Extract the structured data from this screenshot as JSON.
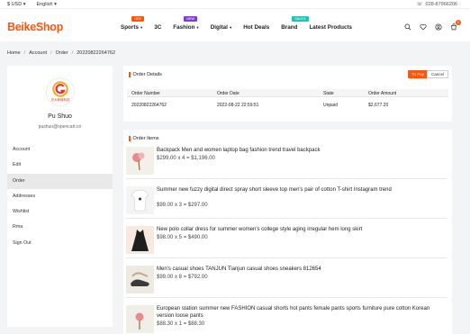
{
  "topbar": {
    "currency": "$ USD",
    "language": "English",
    "phone": "028-87966206"
  },
  "header": {
    "logo": "BeikeShop",
    "nav": [
      {
        "label": "Sports",
        "badge": "HOT",
        "badge_color": "#fd560f",
        "dropdown": true
      },
      {
        "label": "3C",
        "badge": "",
        "badge_color": "",
        "dropdown": false
      },
      {
        "label": "Fashion",
        "badge": "NEW",
        "badge_color": "#7e3fd0",
        "dropdown": true
      },
      {
        "label": "Digital",
        "badge": "",
        "badge_color": "",
        "dropdown": true
      },
      {
        "label": "Hot Deals",
        "badge": "",
        "badge_color": "",
        "dropdown": false
      },
      {
        "label": "Brand",
        "badge": "SALES",
        "badge_color": "#21c1b3",
        "dropdown": false
      },
      {
        "label": "Latest Products",
        "badge": "",
        "badge_color": "",
        "dropdown": false
      }
    ],
    "icons": [
      "search-icon",
      "heart-icon",
      "user-icon",
      "cart-icon"
    ],
    "cart_count": "0"
  },
  "breadcrumb": [
    "Home",
    "Account",
    "Order",
    "20220822264762"
  ],
  "sidebar": {
    "avatar_brand": "光大商城科技",
    "user_name": "Pu Shuo",
    "user_email": "pushuo@opencart.cn",
    "menu": [
      "Account",
      "Edit",
      "Order",
      "Addresses",
      "Wishlist",
      "Rma",
      "Sign Out"
    ],
    "active_index": 2
  },
  "order_details": {
    "title": "Order Details",
    "pay_label": "To Pay",
    "cancel_label": "Cancel",
    "columns": [
      "Order Number",
      "Order Date",
      "State",
      "Order Amount"
    ],
    "row": [
      "20220822264762",
      "2022-08-22 22:59:51",
      "Unpaid",
      "$2,677.20"
    ]
  },
  "order_items": {
    "title": "Order Items",
    "products": [
      {
        "name": "Backpack Men and women laptop bag fashion trend travel backpack",
        "price": "$299.00 x 4 = $1,196.00"
      },
      {
        "name": "Summer new fuzzy digital direct spray short sleeve top men's pair of cotton T-shirt Instagram trend",
        "price": "$99.00 x 3 = $297.00"
      },
      {
        "name": "New polo collar dress for summer women's college style aging irregular hem long skirt",
        "price": "$98.00 x 5 = $490.00"
      },
      {
        "name": "Men's casual shoes TANJUN Tianjun casual shoes sneakers 812654",
        "price": "$99.00 x 8 = $792.00"
      },
      {
        "name": "European station summer new FASHION casual shorts hot pants female pants sports furniture pure cotton Korean version loose pants",
        "price": "$88.30 x 1 = $88.30"
      }
    ]
  },
  "colors": {
    "accent": "#fd560f",
    "page_bg": "#f3f4f6"
  }
}
